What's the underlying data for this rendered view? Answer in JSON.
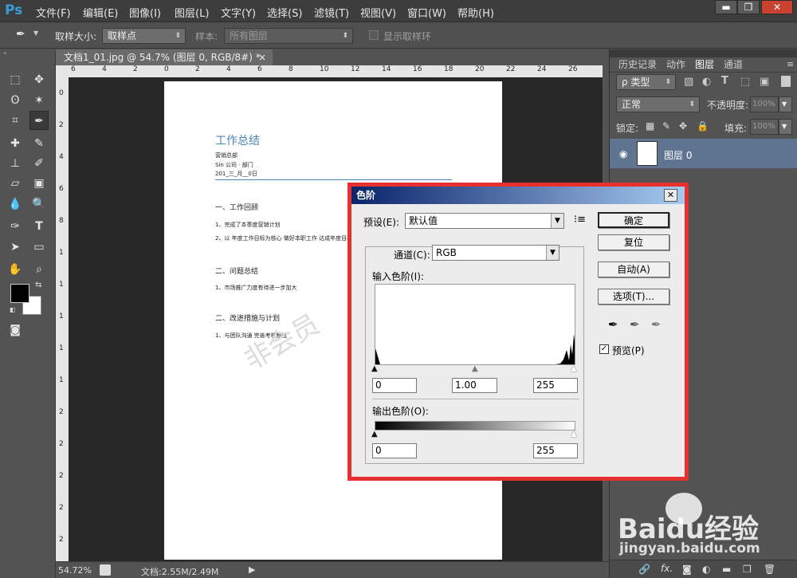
{
  "app": {
    "logo": "Ps"
  },
  "menu": [
    "文件(F)",
    "编辑(E)",
    "图像(I)",
    "图层(L)",
    "文字(Y)",
    "选择(S)",
    "滤镜(T)",
    "视图(V)",
    "窗口(W)",
    "帮助(H)"
  ],
  "window_controls": {
    "minimize": "▬",
    "restore": "❐",
    "close": "✕"
  },
  "options_bar": {
    "sample_size_label": "取样大小:",
    "sample_size_value": "取样点",
    "sample_label": "样本:",
    "sample_value": "所有图层",
    "show_ring_label": "显示取样环"
  },
  "document": {
    "tab_title": "文档1_01.jpg @ 54.7% (图层 0, RGB/8#) *",
    "tab_close": "×",
    "ruler_h": [
      "6",
      "4",
      "2",
      "0",
      "2",
      "4",
      "6",
      "8",
      "10",
      "12",
      "14",
      "16",
      "18",
      "20",
      "22",
      "24",
      "26"
    ],
    "ruler_v": [
      "0",
      "2",
      "4",
      "6",
      "8",
      "1",
      "1",
      "1",
      "1",
      "1",
      "2",
      "2",
      "2",
      "2",
      "2"
    ],
    "content": {
      "title": "工作总结",
      "meta1": "营销总部",
      "meta2": "Sin 公司 · 部门",
      "meta3": "201_三_月__0日",
      "sec1": "一、工作回顾",
      "sec1_l1": "1、完成了本季度营销计划",
      "sec1_l2": "2、以 年度工作目标为核心 做好本职工作 达成年度目标",
      "sec2": "二、问题总结",
      "sec2_l1": "1、市场推广力度有待进一步加大",
      "sec3": "二、改进措施与计划",
      "sec3_l1": "1、与团队沟通 完善考核制度",
      "watermark": "非会员"
    }
  },
  "status": {
    "zoom": "54.72%",
    "doc_info": "文档:2.55M/2.49M"
  },
  "panels": {
    "tabs": [
      "历史记录",
      "动作",
      "图层",
      "通道"
    ],
    "active_tab": "图层",
    "filter_kind": "ρ 类型",
    "blend_mode": "正常",
    "opacity_label": "不透明度:",
    "opacity_value": "100%",
    "lock_label": "锁定:",
    "fill_label": "填充:",
    "fill_value": "100%",
    "layer_name": "图层 0",
    "footer_icons": [
      "link-icon",
      "fx-icon",
      "mask-icon",
      "adjustment-icon",
      "folder-icon",
      "new-layer-icon",
      "trash-icon"
    ],
    "fx_text": "fx."
  },
  "levels_dialog": {
    "title": "色阶",
    "close": "✕",
    "preset_label": "预设(E):",
    "preset_value": "默认值",
    "channel_label": "通道(C):",
    "channel_value": "RGB",
    "input_levels_label": "输入色阶(I):",
    "input_black": "0",
    "input_gamma": "1.00",
    "input_white": "255",
    "output_levels_label": "输出色阶(O):",
    "output_black": "0",
    "output_white": "255",
    "btn_ok": "确定",
    "btn_reset": "复位",
    "btn_auto": "自动(A)",
    "btn_options": "选项(T)...",
    "preview_label": "预览(P)",
    "preview_checked": true
  },
  "watermark_logo": {
    "brand": "Baidu经验",
    "url_text": "jingyan.baidu.com"
  }
}
